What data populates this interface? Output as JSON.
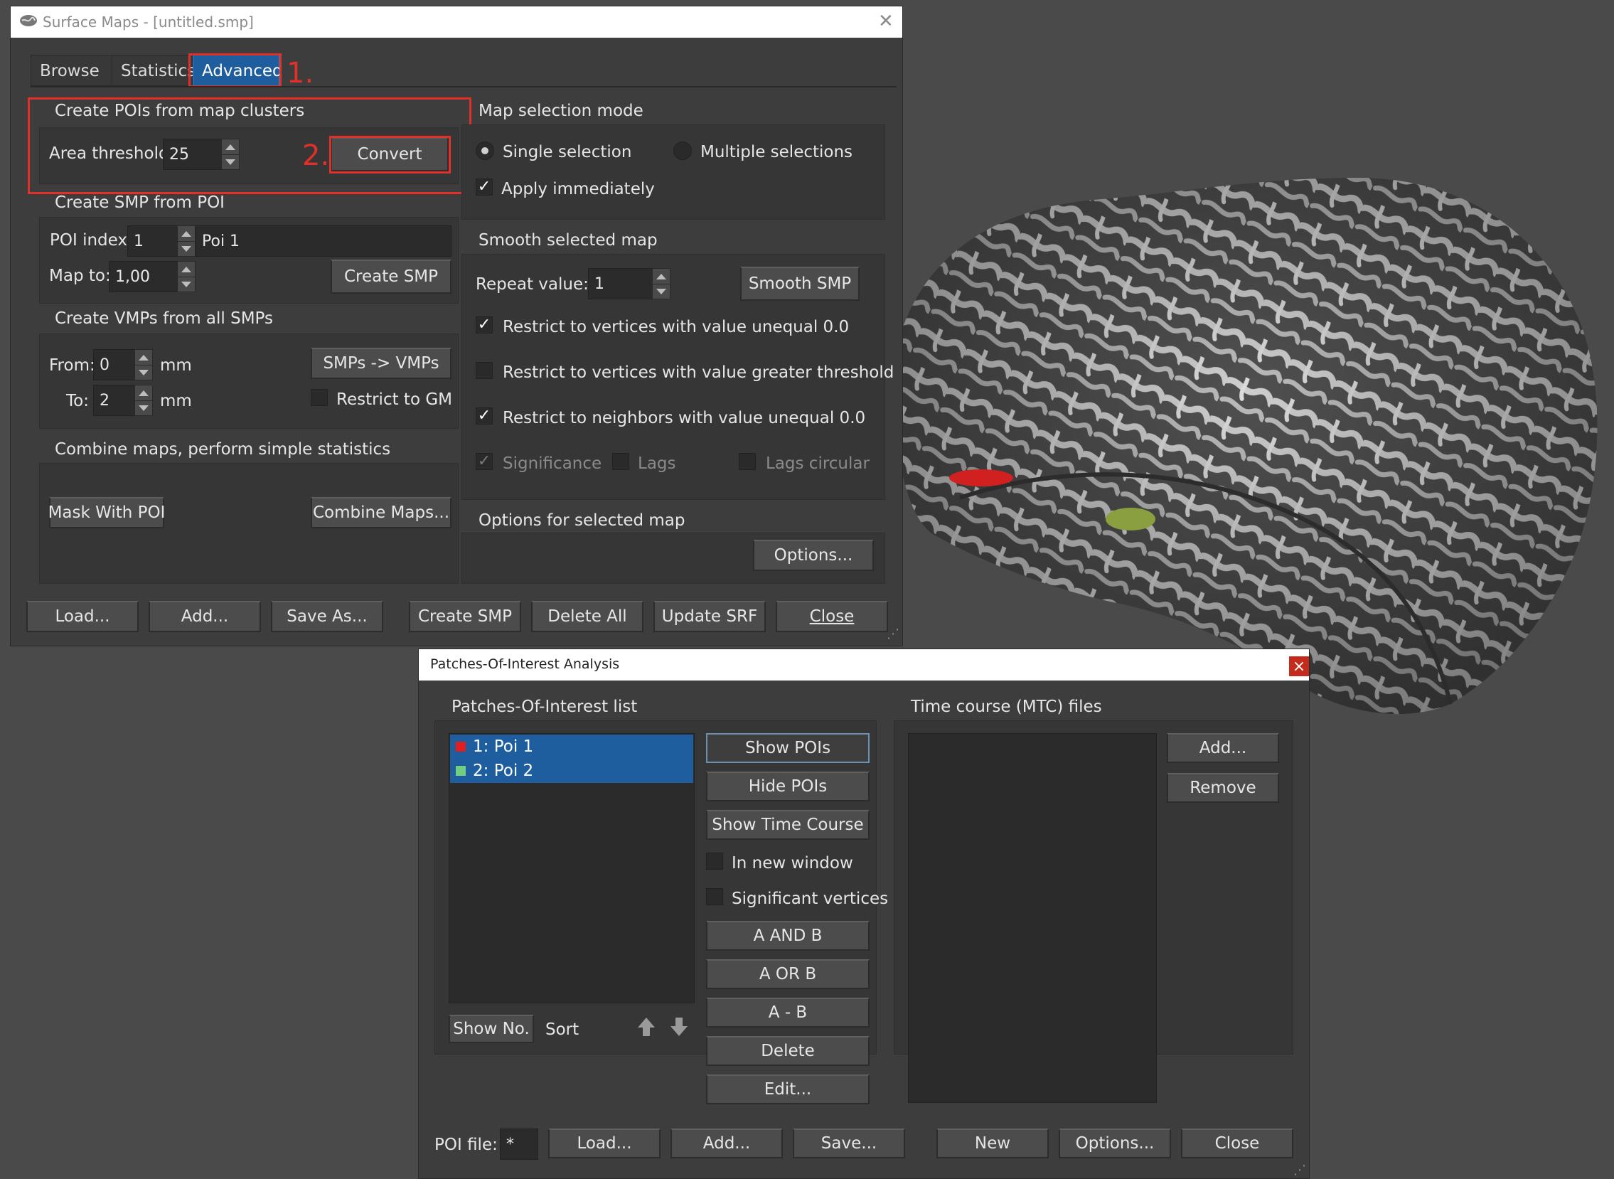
{
  "colors": {
    "desktop": "#4a4a4a",
    "window_bg": "#3d3d3d",
    "accent_red": "#e0302a",
    "selection_blue": "#1f5e9e",
    "poi1_color": "#e02020",
    "poi2_color": "#70d080"
  },
  "surface_maps": {
    "title": "Surface Maps - [untitled.smp]",
    "tabs": [
      "Browse",
      "Statistics",
      "Advanced"
    ],
    "active_tab": "Advanced",
    "annotations": {
      "step1": "1.",
      "step2": "2."
    },
    "create_pois": {
      "group_label": "Create POIs from map clusters",
      "area_threshold_label": "Area threshold:",
      "area_threshold_value": "25",
      "convert_label": "Convert"
    },
    "create_smp": {
      "group_label": "Create SMP from POI",
      "poi_index_label": "POI index:",
      "poi_index_value": "1",
      "poi_name_value": "Poi 1",
      "map_to_label": "Map to:",
      "map_to_value": "1,00",
      "create_smp_label": "Create SMP"
    },
    "create_vmps": {
      "group_label": "Create VMPs from all SMPs",
      "from_label": "From:",
      "from_value": "0",
      "from_unit": "mm",
      "to_label": "To:",
      "to_value": "2",
      "to_unit": "mm",
      "smps_to_vmps_label": "SMPs -> VMPs",
      "restrict_gm_label": "Restrict to GM"
    },
    "combine": {
      "group_label": "Combine maps, perform simple statistics",
      "mask_label": "Mask With POI",
      "combine_label": "Combine Maps..."
    },
    "map_selection": {
      "group_label": "Map selection mode",
      "single_label": "Single selection",
      "multiple_label": "Multiple selections",
      "apply_label": "Apply immediately",
      "check_mark": "✓"
    },
    "smooth": {
      "group_label": "Smooth selected map",
      "repeat_label": "Repeat value:",
      "repeat_value": "1",
      "smooth_label": "Smooth SMP",
      "restrict_unequal_label": "Restrict to vertices with value unequal 0.0",
      "restrict_greater_label": "Restrict to vertices with value greater threshold",
      "restrict_neighbors_label": "Restrict to neighbors with value unequal 0.0",
      "significance_label": "Significance",
      "lags_label": "Lags",
      "lags_circular_label": "Lags circular"
    },
    "options_group": {
      "group_label": "Options for selected map",
      "options_label": "Options..."
    },
    "bottom_buttons": [
      "Load...",
      "Add...",
      "Save As...",
      "Create SMP",
      "Delete All",
      "Update SRF",
      "Close"
    ]
  },
  "poi_analysis": {
    "title": "Patches-Of-Interest Analysis",
    "close_glyph": "×",
    "list_label": "Patches-Of-Interest list",
    "items": [
      "1: Poi 1",
      "2: Poi 2"
    ],
    "show_no_label": "Show No.",
    "sort_label": "Sort",
    "action_buttons": [
      "Show POIs",
      "Hide POIs",
      "Show Time Course"
    ],
    "in_new_window_label": "In new window",
    "significant_vertices_label": "Significant vertices",
    "logic_buttons": [
      "A AND B",
      "A OR B",
      "A - B",
      "Delete",
      "Edit..."
    ],
    "mtc_label": "Time course (MTC) files",
    "mtc_add_label": "Add...",
    "mtc_remove_label": "Remove",
    "poi_file_label": "POI file:",
    "poi_file_value": "*",
    "bottom_buttons": [
      "Load...",
      "Add...",
      "Save...",
      "New",
      "Options...",
      "Close"
    ]
  }
}
